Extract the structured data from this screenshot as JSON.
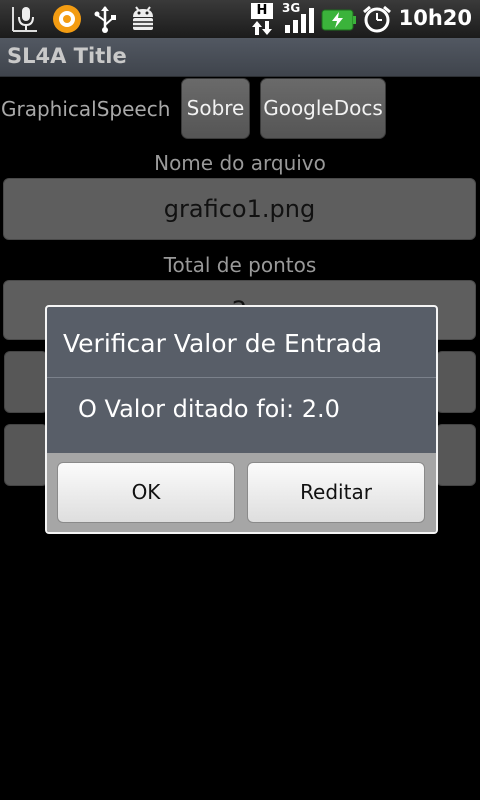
{
  "status_bar": {
    "time": "10h20",
    "network_type": "3G",
    "data_indicator": "H",
    "icons": [
      "voice-search-icon",
      "notification-app-icon",
      "usb-icon",
      "android-debug-icon",
      "data-arrows-icon",
      "signal-icon",
      "battery-charging-icon",
      "alarm-icon"
    ]
  },
  "title_bar": {
    "title": "SL4A Title"
  },
  "main": {
    "app_label": "GraphicalSpeech",
    "buttons": {
      "about": "Sobre",
      "google_docs": "GoogleDocs"
    },
    "filename_label": "Nome do arquivo",
    "filename_value": "grafico1.png",
    "total_points_label": "Total de pontos",
    "total_points_value": "2"
  },
  "dialog": {
    "title": "Verificar Valor de Entrada",
    "message": "O Valor ditado foi: 2.0",
    "ok_label": "OK",
    "redo_label": "Reditar"
  },
  "colors": {
    "battery": "#3bb33b",
    "background": "#000000",
    "dialog_body": "#585e68"
  }
}
